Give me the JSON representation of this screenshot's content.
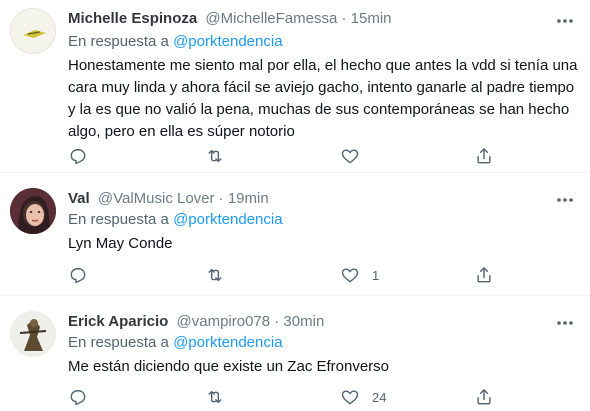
{
  "tweets": [
    {
      "author_name": "Michelle Espinoza",
      "author_meta": "@MichelleFamessa · 15min",
      "reply_prefix": "En respuesta a",
      "reply_handle": "@porktendencia",
      "text": "Honestamente me siento mal por ella, el hecho que antes la vdd si tenía una cara muy linda y ahora fácil se aviejo gacho, intento ganarle al padre tiempo y la es que no valió la pena, muchas de sus contemporáneas se han hecho algo, pero en ella es súper notorio",
      "like_count": ""
    },
    {
      "author_name": "Val",
      "author_meta": "@ValMusic Lover · 19min",
      "reply_prefix": "En respuesta a",
      "reply_handle": "@porktendencia",
      "text": "Lyn May Conde",
      "like_count": "1"
    },
    {
      "author_name": "Erick Aparicio",
      "author_meta": "@vampiro078 · 30min",
      "reply_prefix": "En respuesta a",
      "reply_handle": "@porktendencia",
      "text": "Me están diciendo que existe un Zac Efronverso",
      "like_count": "24"
    }
  ],
  "icons": {
    "reply": "reply-icon",
    "retweet": "retweet-icon",
    "like": "heart-icon",
    "share": "share-icon",
    "more": "more-options-icon"
  },
  "colors": {
    "link": "#1d9bf0",
    "secondary": "#536471",
    "divider": "#eff3f4"
  }
}
